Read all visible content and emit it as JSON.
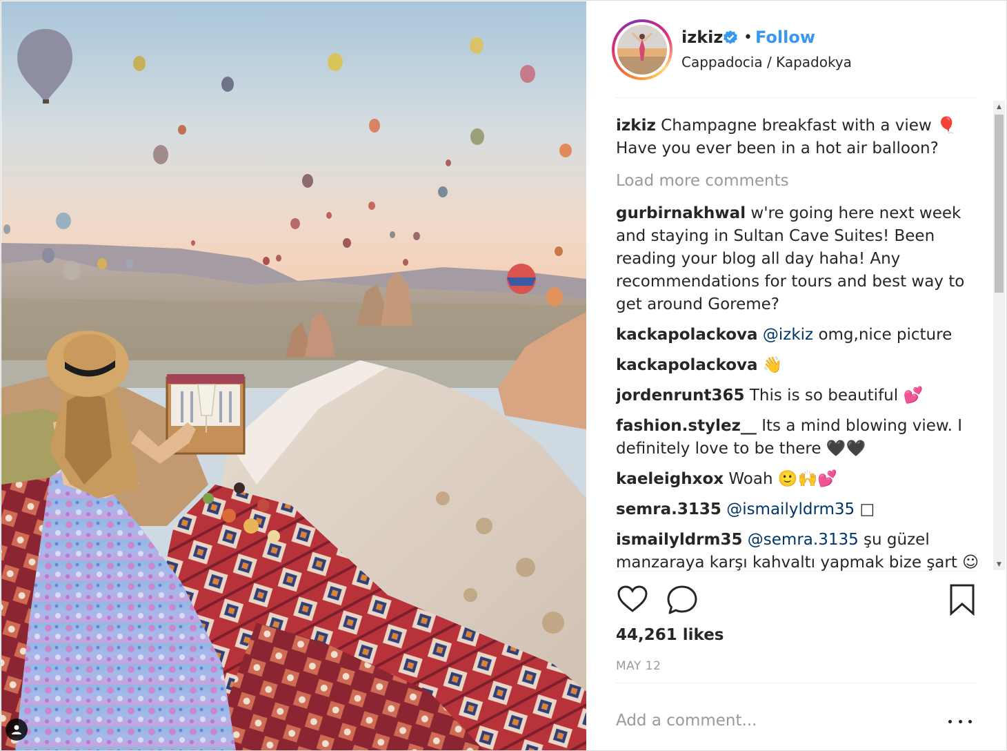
{
  "post": {
    "username": "izkiz",
    "follow_label": "Follow",
    "location": "Cappadocia / Kapadokya",
    "verified": true
  },
  "caption": {
    "username": "izkiz",
    "text": "Champagne breakfast with a view 🎈 Have you ever been in a hot air balloon?"
  },
  "load_more_label": "Load more comments",
  "comments": [
    {
      "user": "gurbirnakhwal",
      "mention": "",
      "text": "w're going here next week and staying in Sultan Cave Suites! Been reading your blog all day haha! Any recommendations for tours and best way to get around Goreme?"
    },
    {
      "user": "kackapolackova",
      "mention": "@izkiz",
      "text": "omg,nice picture"
    },
    {
      "user": "kackapolackova",
      "mention": "",
      "text": "👋"
    },
    {
      "user": "jordenrunt365",
      "mention": "",
      "text": "This is so beautiful 💕"
    },
    {
      "user": "fashion.stylez__",
      "mention": "",
      "text": "Its a mind blowing view. I definitely love to be there 🖤🖤"
    },
    {
      "user": "kaeleighxox",
      "mention": "",
      "text": "Woah 🙂🙌💕"
    },
    {
      "user": "semra.3135",
      "mention": "@ismailyldrm35",
      "text": "□"
    },
    {
      "user": "ismailyldrm35",
      "mention": "@semra.3135",
      "text": "şu güzel manzaraya karşı kahvaltı yapmak bize şart ☺"
    }
  ],
  "likes_text": "44,261 likes",
  "date_text": "MAY 12",
  "comment_box": {
    "placeholder": "Add a comment..."
  },
  "icons": {
    "like": "heart-icon",
    "comment": "comment-bubble-icon",
    "save": "bookmark-icon",
    "more": "more-options-icon",
    "user_tag": "user-tag-icon",
    "verified": "verified-badge-icon"
  },
  "colors": {
    "follow": "#3897f0",
    "muted": "#999999",
    "text": "#262626",
    "mention": "#003569"
  }
}
